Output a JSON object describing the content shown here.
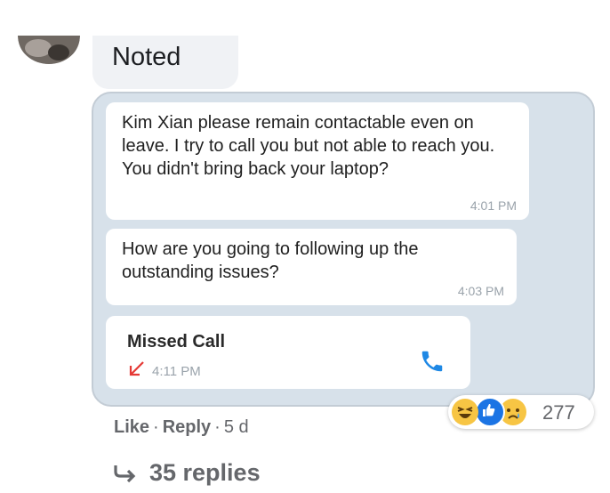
{
  "top_reply": {
    "text": "Noted"
  },
  "screenshot": {
    "messages": [
      {
        "text": "Kim Xian please remain contactable even on leave. I try to call you but not able to reach you. You didn't bring back your laptop?",
        "time": "4:01 PM"
      },
      {
        "text": "How are you going to following up the outstanding issues?",
        "time": "4:03 PM"
      }
    ],
    "missed_call": {
      "title": "Missed Call",
      "time": "4:11 PM",
      "icon": "phone-icon"
    }
  },
  "reactions": {
    "count": "277",
    "icons": [
      "laugh-emoji-icon",
      "like-emoji-icon",
      "sad-emoji-icon"
    ]
  },
  "actions": {
    "like": "Like",
    "reply": "Reply",
    "age": "5 d",
    "separator": "·"
  },
  "replies": {
    "label": "35 replies",
    "icon": "reply-arrow-icon"
  },
  "colors": {
    "missed_call_arrow": "#e53935",
    "phone": "#1e88e5",
    "like_blue": "#1b74e4"
  }
}
